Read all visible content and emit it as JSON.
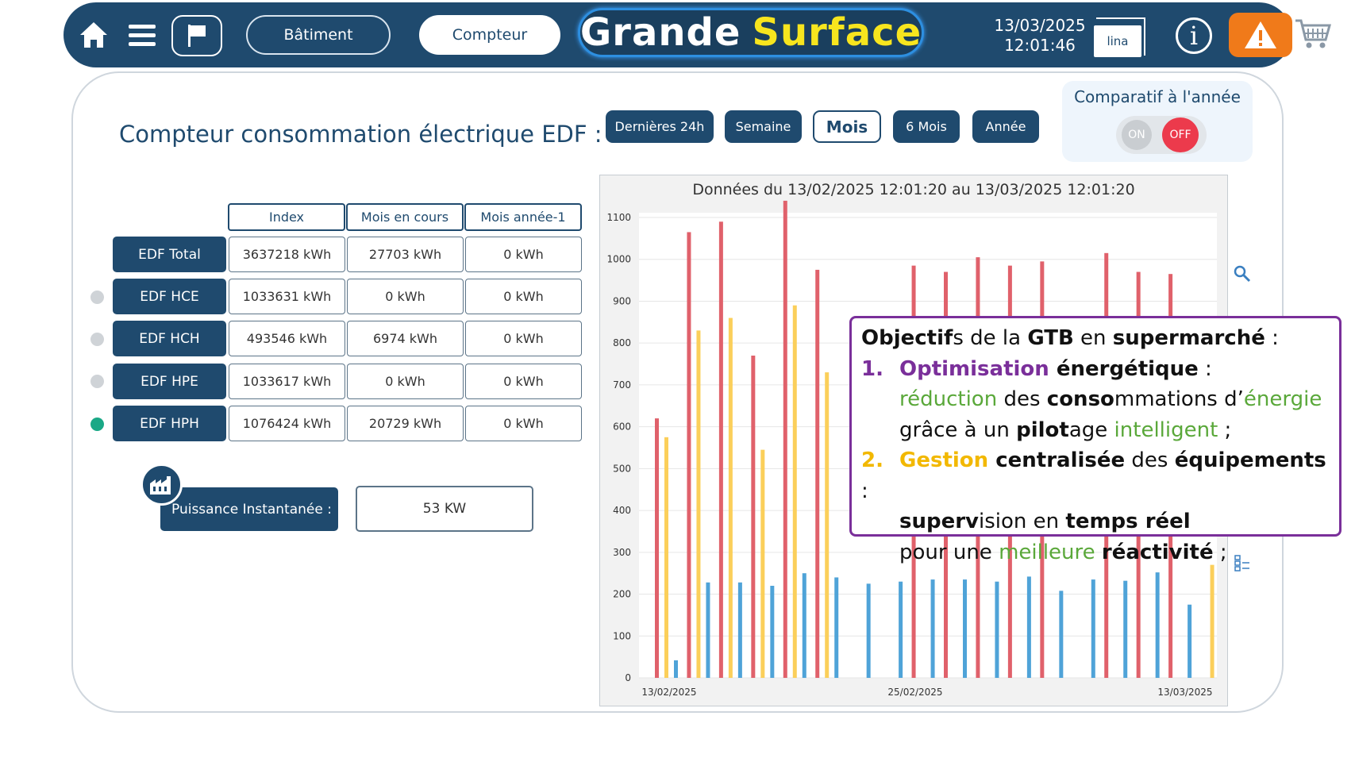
{
  "topbar": {
    "batiment_label": "Bâtiment",
    "compteur_label": "Compteur",
    "title_part1": "Grande",
    "title_part2": "Surface",
    "date": "13/03/2025",
    "time": "12:01:46",
    "lina_label": "lina",
    "info_label": "i"
  },
  "page_title": "Compteur consommation électrique EDF :",
  "periods": [
    "Dernières 24h",
    "Semaine",
    "Mois",
    "6 Mois",
    "Année"
  ],
  "active_period": "Mois",
  "comparatif": {
    "label": "Comparatif à l'année",
    "on_label": "ON",
    "off_label": "OFF"
  },
  "table": {
    "headers": [
      "Index",
      "Mois en cours",
      "Mois année-1"
    ],
    "rows": [
      {
        "label": "EDF Total",
        "index": "3637218 kWh",
        "mois": "27703 kWh",
        "annee": "0 kWh"
      },
      {
        "label": "EDF HCE",
        "index": "1033631 kWh",
        "mois": "0 kWh",
        "annee": "0 kWh"
      },
      {
        "label": "EDF HCH",
        "index": "493546 kWh",
        "mois": "6974 kWh",
        "annee": "0 kWh"
      },
      {
        "label": "EDF HPE",
        "index": "1033617 kWh",
        "mois": "0 kWh",
        "annee": "0 kWh"
      },
      {
        "label": "EDF HPH",
        "index": "1076424 kWh",
        "mois": "20729 kWh",
        "annee": "0 kWh"
      }
    ]
  },
  "puissance": {
    "label": "Puissance Instantanée :",
    "value": "53 KW"
  },
  "chart_data": {
    "type": "bar",
    "title": "Données du 13/02/2025 12:01:20 au 13/03/2025 12:01:20",
    "ylim": [
      0,
      1100
    ],
    "yticks": [
      "0",
      "100",
      "200",
      "300",
      "400",
      "500",
      "600",
      "700",
      "800",
      "900",
      "1000",
      "1100"
    ],
    "x_tick_labels": [
      "13/02/2025",
      "25/02/2025",
      "13/03/2025"
    ],
    "grid": true,
    "colors": {
      "red": "#e0616b",
      "yellow": "#fbcf5a",
      "blue": "#4fa3d8"
    },
    "series": [
      {
        "color": "red",
        "values": [
          620,
          1065,
          1090,
          770,
          1140,
          975,
          0,
          0,
          985,
          970,
          1005,
          985,
          995,
          0,
          1015,
          970,
          965,
          0
        ]
      },
      {
        "color": "yellow",
        "values": [
          575,
          830,
          860,
          545,
          890,
          730,
          0,
          0,
          0,
          0,
          0,
          0,
          0,
          0,
          0,
          0,
          0,
          270
        ]
      },
      {
        "color": "blue",
        "values": [
          42,
          228,
          228,
          220,
          250,
          240,
          225,
          230,
          235,
          235,
          230,
          242,
          208,
          235,
          232,
          252,
          175,
          0
        ]
      }
    ]
  },
  "callout": {
    "heading_b1": "Objectif",
    "heading_t1": "s de la ",
    "heading_b2": "GTB",
    "heading_t2": " en ",
    "heading_b3": "supermarché",
    "heading_t3": " :",
    "item1_num": "1.",
    "item1_c": "Optimisation",
    "item1_b": " énergétique",
    "item1_t": " :",
    "line2_g1": "réduction",
    "line2_t1": " des ",
    "line2_b1": "conso",
    "line2_t2": "mmations d’",
    "line2_g2": "énergie",
    "line3_t1": "grâce à un ",
    "line3_b1": "pilot",
    "line3_t2": "age ",
    "line3_g1": "intelligent",
    "line3_t3": " ;",
    "item2_num": "2.",
    "item2_c": "Gestion",
    "item2_b1": " centralisée",
    "item2_t1": " des ",
    "item2_b2": "équipements",
    "item2_t2": " :",
    "line5_b1": "superv",
    "line5_t1": "ision en ",
    "line5_b2": "temps réel",
    "line6_t1": "pour une ",
    "line6_g1": "meilleure",
    "line6_t2": " ",
    "line6_b1": "réactivité",
    "line6_t3": " ;"
  }
}
